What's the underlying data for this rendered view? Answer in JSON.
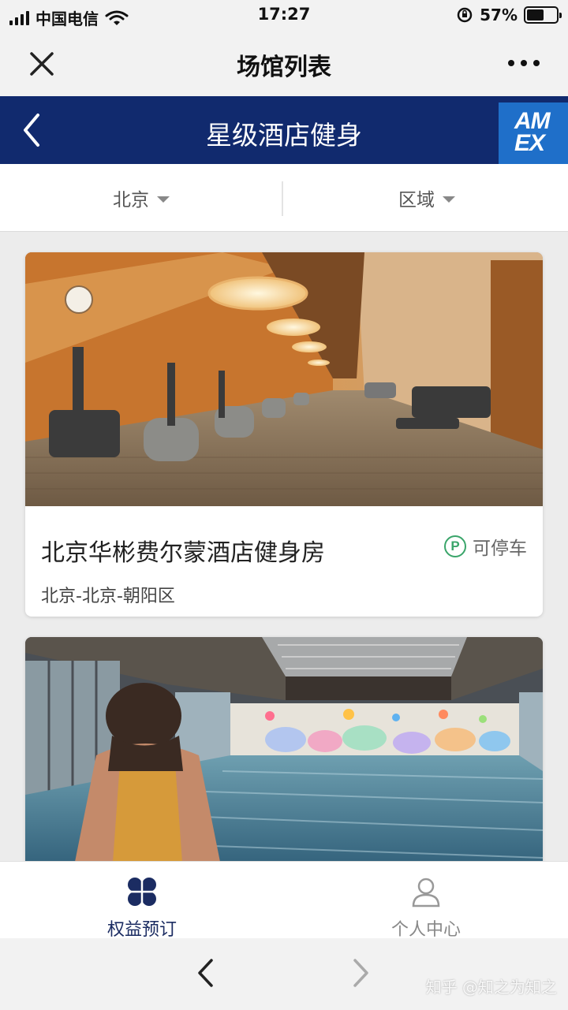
{
  "status_bar": {
    "carrier": "中国电信",
    "time": "17:27",
    "battery_percent": "57%",
    "battery_level": 0.57
  },
  "mini_program": {
    "title": "场馆列表"
  },
  "nav": {
    "title": "星级酒店健身",
    "logo_line1": "AM",
    "logo_line2": "EX",
    "bar_color": "#112a6e",
    "logo_color": "#1f6fc9"
  },
  "filters": {
    "city": "北京",
    "region": "区域"
  },
  "venues": [
    {
      "name": "北京华彬费尔蒙酒店健身房",
      "address": "北京-北京-朝阳区",
      "parking_label": "可停车",
      "parking_icon": "P"
    }
  ],
  "tabs": [
    {
      "label": "权益预订",
      "icon": "clover-icon",
      "active": true
    },
    {
      "label": "个人中心",
      "icon": "person-icon",
      "active": false
    }
  ],
  "watermark": "知乎 @知之为知之"
}
